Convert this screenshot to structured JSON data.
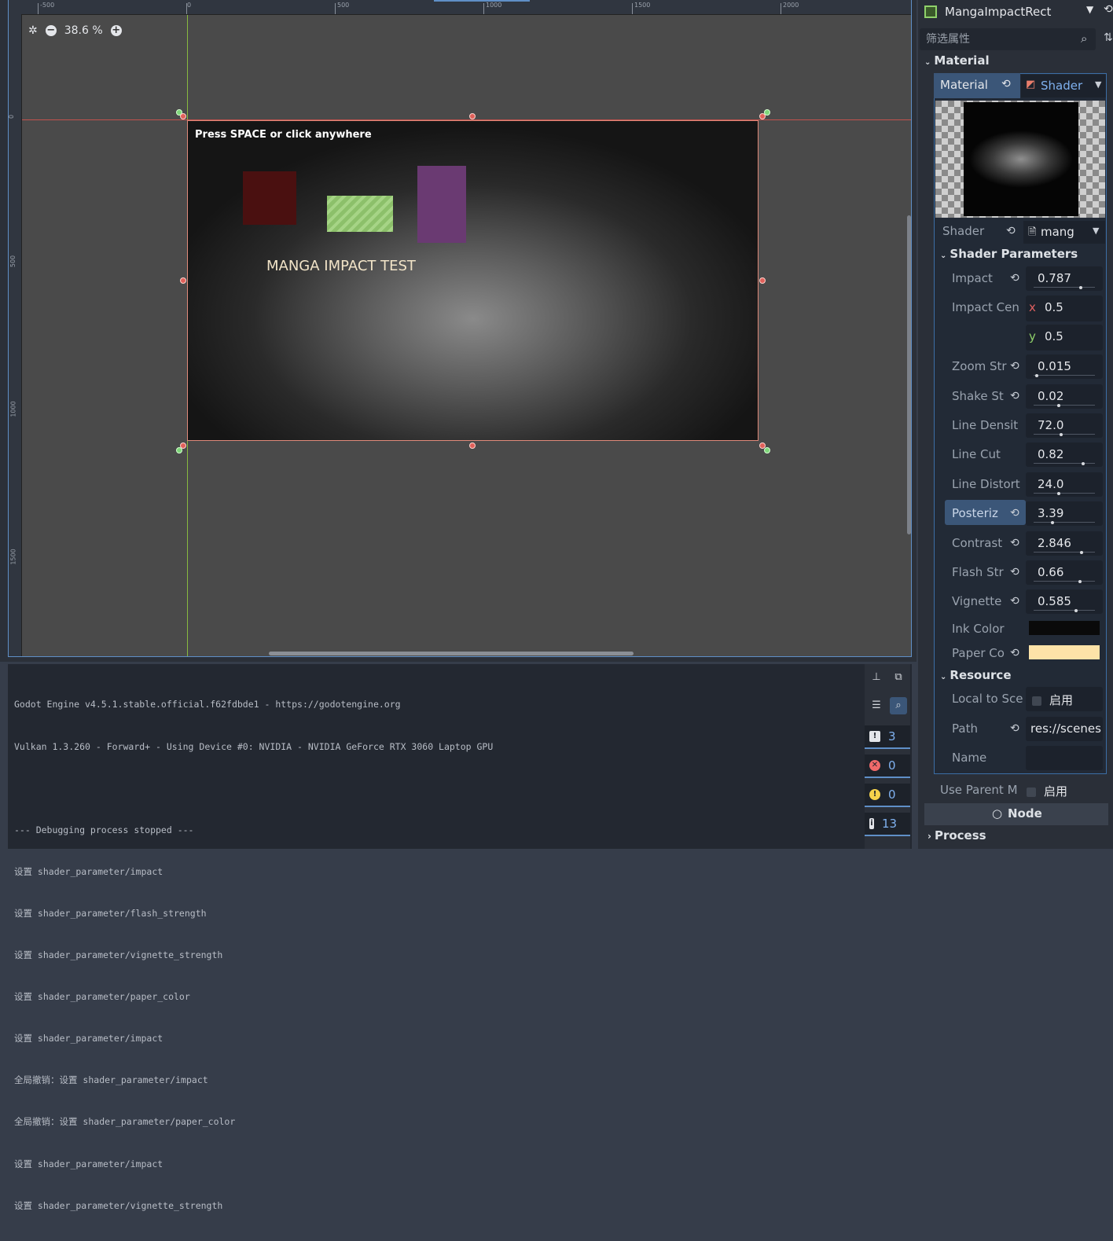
{
  "viewport": {
    "zoom_label": "38.6 %",
    "ruler_top_labels": [
      "-500",
      "0",
      "500",
      "1000",
      "1500",
      "2000"
    ],
    "ruler_left_labels": [
      "0",
      "500",
      "1000",
      "1500"
    ],
    "game_hint": "Press SPACE or click anywhere",
    "game_title": "MANGA IMPACT TEST"
  },
  "output": {
    "lines": [
      "Godot Engine v4.5.1.stable.official.f62fdbde1 - https://godotengine.org",
      "Vulkan 1.3.260 - Forward+ - Using Device #0: NVIDIA - NVIDIA GeForce RTX 3060 Laptop GPU",
      "",
      "--- Debugging process stopped ---",
      "设置 shader_parameter/impact",
      "设置 shader_parameter/flash_strength",
      "设置 shader_parameter/vignette_strength",
      "设置 shader_parameter/paper_color",
      "设置 shader_parameter/impact",
      "全局撤销：设置 shader_parameter/impact",
      "全局撤销：设置 shader_parameter/paper_color",
      "设置 shader_parameter/impact",
      "设置 shader_parameter/vignette_strength"
    ],
    "counts": {
      "messages": "3",
      "errors": "0",
      "warnings": "0",
      "info": "13"
    }
  },
  "inspector": {
    "node_name": "MangaImpactRect",
    "filter_placeholder": "筛选属性",
    "material_section": "Material",
    "material_tab": "Material",
    "shader_tab": "Shader",
    "shader_label": "Shader",
    "shader_value": "mang",
    "shader_params_section": "Shader Parameters",
    "params": [
      {
        "label": "Impact",
        "value": "0.787",
        "level": 0.787,
        "reset": true
      },
      {
        "label": "Zoom Str",
        "value": "0.015",
        "level": 0.03,
        "reset": true
      },
      {
        "label": "Shake St",
        "value": "0.02",
        "level": 0.4,
        "reset": true
      },
      {
        "label": "Line Densit",
        "value": "72.0",
        "level": 0.45,
        "reset": false
      },
      {
        "label": "Line Cut",
        "value": "0.82",
        "level": 0.82,
        "reset": false
      },
      {
        "label": "Line Distort",
        "value": "24.0",
        "level": 0.4,
        "reset": false
      },
      {
        "label": "Posteriz",
        "value": "3.39",
        "level": 0.3,
        "reset": true,
        "selected": true
      },
      {
        "label": "Contrast",
        "value": "2.846",
        "level": 0.8,
        "reset": true
      },
      {
        "label": "Flash Str",
        "value": "0.66",
        "level": 0.77,
        "reset": true
      },
      {
        "label": "Vignette",
        "value": "0.585",
        "level": 0.7,
        "reset": true
      }
    ],
    "impact_center": {
      "label": "Impact Cen",
      "x_axis": "x",
      "x": "0.5",
      "y_axis": "y",
      "y": "0.5"
    },
    "ink_color": {
      "label": "Ink Color",
      "color": "#0a0a0a"
    },
    "paper_color": {
      "label": "Paper Co",
      "color": "#fde3a8"
    },
    "resource_section": "Resource",
    "local_to_scene": {
      "label": "Local to Sce",
      "value": "启用"
    },
    "path": {
      "label": "Path",
      "value": "res://scenes"
    },
    "name": {
      "label": "Name",
      "value": ""
    },
    "use_parent": {
      "label": "Use Parent M",
      "value": "启用"
    },
    "node_section": "Node",
    "process_section": "Process"
  },
  "colors": {
    "accent": "#5f8fc7",
    "guide_v": "#8fc63f",
    "guide_h": "#d9534f"
  }
}
